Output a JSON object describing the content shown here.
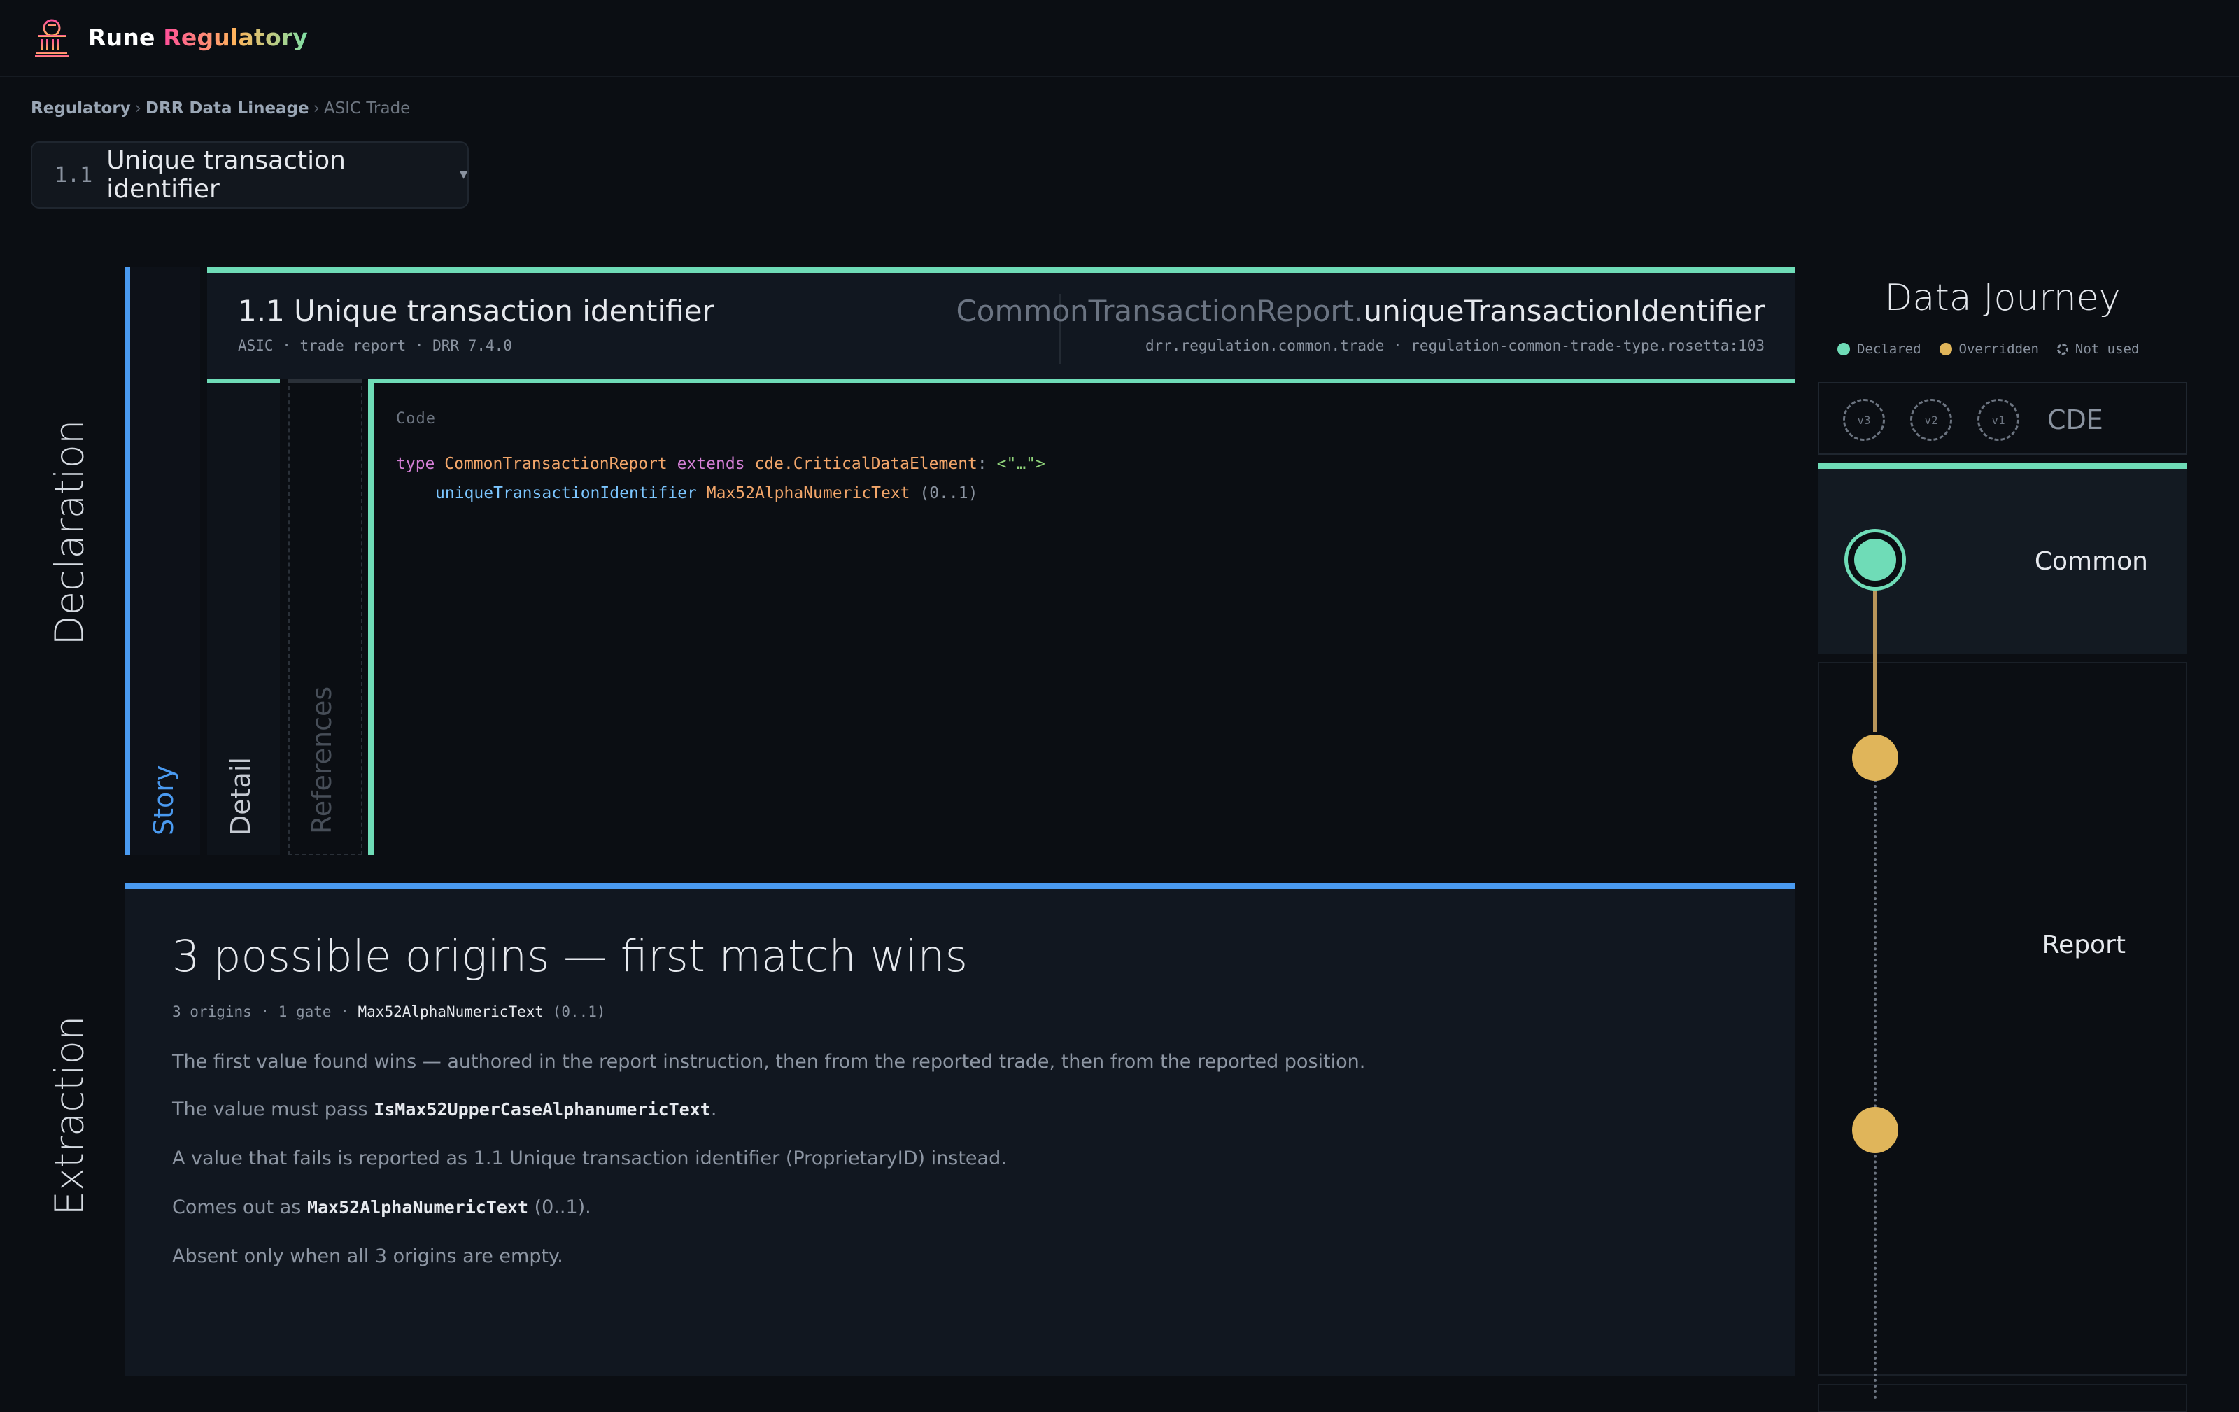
{
  "header": {
    "brand_first": "Rune",
    "brand_second": "Regulatory"
  },
  "breadcrumb": {
    "items": [
      "Regulatory",
      "DRR Data Lineage"
    ],
    "current": "ASIC Trade"
  },
  "selector": {
    "number": "1.1",
    "label": "Unique transaction identifier"
  },
  "sections": {
    "declaration": "Declaration",
    "extraction": "Extraction"
  },
  "tabs": {
    "story": "Story",
    "detail": "Detail",
    "references": "References"
  },
  "declaration": {
    "title": "1.1 Unique transaction identifier",
    "meta": "ASIC · trade report · DRR 7.4.0",
    "path_type": "CommonTransactionReport.",
    "path_attr": "uniqueTransactionIdentifier",
    "path_meta": "drr.regulation.common.trade · regulation-common-trade-type.rosetta:103",
    "code_caption": "Code",
    "code": {
      "kw_type": "type",
      "type_name": "CommonTransactionReport",
      "kw_extends": "extends",
      "super_type": "cde.CriticalDataElement",
      "colon": ":",
      "doc": "<\"…\">",
      "attr_name": "uniqueTransactionIdentifier",
      "attr_type": "Max52AlphaNumericText",
      "cardinality": "(0..1)"
    }
  },
  "extraction": {
    "heading": "3 possible origins — first match wins",
    "sub_prefix": "3 origins · 1 gate · ",
    "sub_type": "Max52AlphaNumericText",
    "sub_card": " (0..1)",
    "p1": "The first value found wins — authored in the report instruction, then from the reported trade, then from the reported position.",
    "p2_prefix": "The value must pass ",
    "p2_code": "IsMax52UpperCaseAlphanumericText",
    "p2_suffix": ".",
    "p3": "A value that fails is reported as 1.1 Unique transaction identifier (ProprietaryID) instead.",
    "p4_prefix": "Comes out as ",
    "p4_code": "Max52AlphaNumericText",
    "p4_suffix": " (0..1).",
    "p5": "Absent only when all 3 origins are empty."
  },
  "journey": {
    "title": "Data Journey",
    "legend": {
      "declared": "Declared",
      "overridden": "Overridden",
      "not_used": "Not used"
    },
    "versions": [
      "v3",
      "v2",
      "v1"
    ],
    "cde_label": "CDE",
    "common_label": "Common",
    "report_label": "Report",
    "colors": {
      "declared": "#6fdcb7",
      "overridden": "#e0b55a",
      "accent_blue": "#4a9af0"
    }
  }
}
